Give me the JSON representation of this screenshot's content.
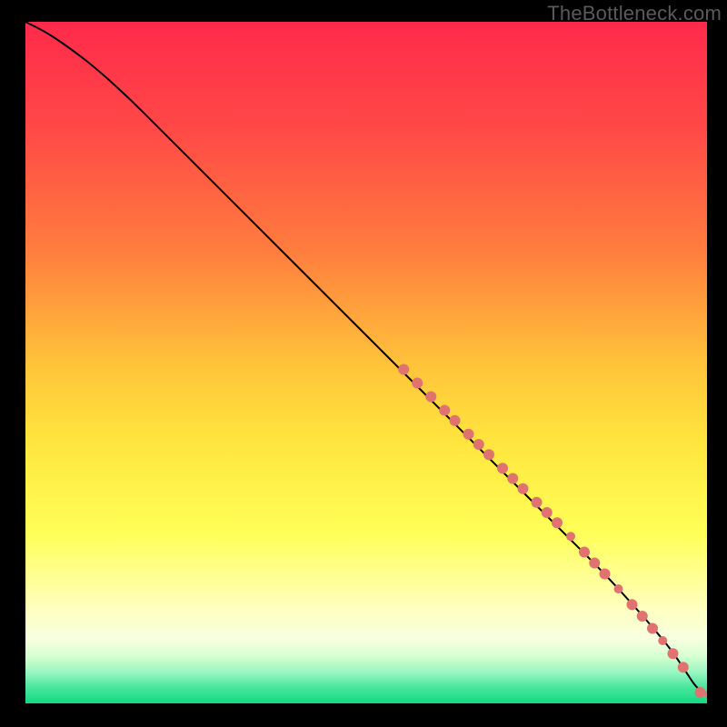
{
  "watermark": "TheBottleneck.com",
  "chart_data": {
    "type": "line",
    "title": "",
    "xlabel": "",
    "ylabel": "",
    "xlim": [
      0,
      100
    ],
    "ylim": [
      0,
      100
    ],
    "grid": false,
    "legend": false,
    "series": [
      {
        "name": "curve",
        "x": [
          0,
          3,
          6,
          10,
          15,
          20,
          25,
          30,
          35,
          40,
          45,
          50,
          55,
          60,
          65,
          70,
          75,
          80,
          85,
          90,
          93,
          95,
          97,
          98.5,
          100
        ],
        "y": [
          100,
          98.5,
          96.5,
          93.5,
          89,
          84,
          79,
          74,
          69,
          64,
          59,
          54,
          49,
          44,
          39,
          34,
          29,
          24,
          19,
          13.5,
          10,
          7.5,
          4.5,
          2.2,
          1.3
        ]
      }
    ],
    "markers": [
      {
        "x": 55.5,
        "y": 49.0,
        "r": 6
      },
      {
        "x": 57.5,
        "y": 47.0,
        "r": 6
      },
      {
        "x": 59.5,
        "y": 45.0,
        "r": 6
      },
      {
        "x": 61.5,
        "y": 43.0,
        "r": 6
      },
      {
        "x": 63.0,
        "y": 41.5,
        "r": 6
      },
      {
        "x": 65.0,
        "y": 39.5,
        "r": 6
      },
      {
        "x": 66.5,
        "y": 38.0,
        "r": 6
      },
      {
        "x": 68.0,
        "y": 36.5,
        "r": 6
      },
      {
        "x": 70.0,
        "y": 34.5,
        "r": 6
      },
      {
        "x": 71.5,
        "y": 33.0,
        "r": 6
      },
      {
        "x": 73.0,
        "y": 31.5,
        "r": 6
      },
      {
        "x": 75.0,
        "y": 29.5,
        "r": 6
      },
      {
        "x": 76.5,
        "y": 28.0,
        "r": 6
      },
      {
        "x": 78.0,
        "y": 26.5,
        "r": 6
      },
      {
        "x": 80.0,
        "y": 24.5,
        "r": 5
      },
      {
        "x": 82.0,
        "y": 22.2,
        "r": 6
      },
      {
        "x": 83.5,
        "y": 20.6,
        "r": 6
      },
      {
        "x": 85.0,
        "y": 19.0,
        "r": 6
      },
      {
        "x": 87.0,
        "y": 16.8,
        "r": 5
      },
      {
        "x": 89.0,
        "y": 14.5,
        "r": 6
      },
      {
        "x": 90.5,
        "y": 12.8,
        "r": 6
      },
      {
        "x": 92.0,
        "y": 11.0,
        "r": 6
      },
      {
        "x": 93.5,
        "y": 9.2,
        "r": 5
      },
      {
        "x": 95.0,
        "y": 7.3,
        "r": 6
      },
      {
        "x": 96.5,
        "y": 5.3,
        "r": 6
      },
      {
        "x": 99.0,
        "y": 1.6,
        "r": 6
      },
      {
        "x": 100.5,
        "y": 1.3,
        "r": 6
      }
    ],
    "background_gradient_stops": [
      {
        "offset": 0.0,
        "color": "#ff2a4b"
      },
      {
        "offset": 0.15,
        "color": "#ff4747"
      },
      {
        "offset": 0.33,
        "color": "#ff7b3e"
      },
      {
        "offset": 0.5,
        "color": "#ffc23a"
      },
      {
        "offset": 0.62,
        "color": "#ffe63e"
      },
      {
        "offset": 0.75,
        "color": "#ffff58"
      },
      {
        "offset": 0.86,
        "color": "#ffffbe"
      },
      {
        "offset": 0.905,
        "color": "#f7ffe0"
      },
      {
        "offset": 0.93,
        "color": "#d8ffd2"
      },
      {
        "offset": 0.955,
        "color": "#98f5c0"
      },
      {
        "offset": 0.975,
        "color": "#4de8a0"
      },
      {
        "offset": 1.0,
        "color": "#12d980"
      }
    ],
    "marker_color": "#e0736f",
    "line_color": "#000000"
  }
}
